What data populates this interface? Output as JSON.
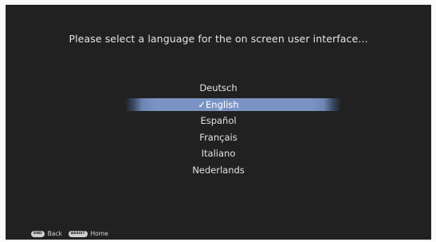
{
  "prompt": "Please select a language for the on screen user interface...",
  "languages": [
    {
      "label": "Deutsch"
    },
    {
      "label": "✓English"
    },
    {
      "label": "Español"
    },
    {
      "label": "Français"
    },
    {
      "label": "Italiano"
    },
    {
      "label": "Nederlands"
    }
  ],
  "selected_index": 1,
  "footer": {
    "back_key": "END",
    "back_label": "Back",
    "home_key": "ASSIST",
    "home_label": "Home"
  },
  "colors": {
    "background": "#212121",
    "highlight": "#7b94c4",
    "text": "#e2e2e2"
  }
}
